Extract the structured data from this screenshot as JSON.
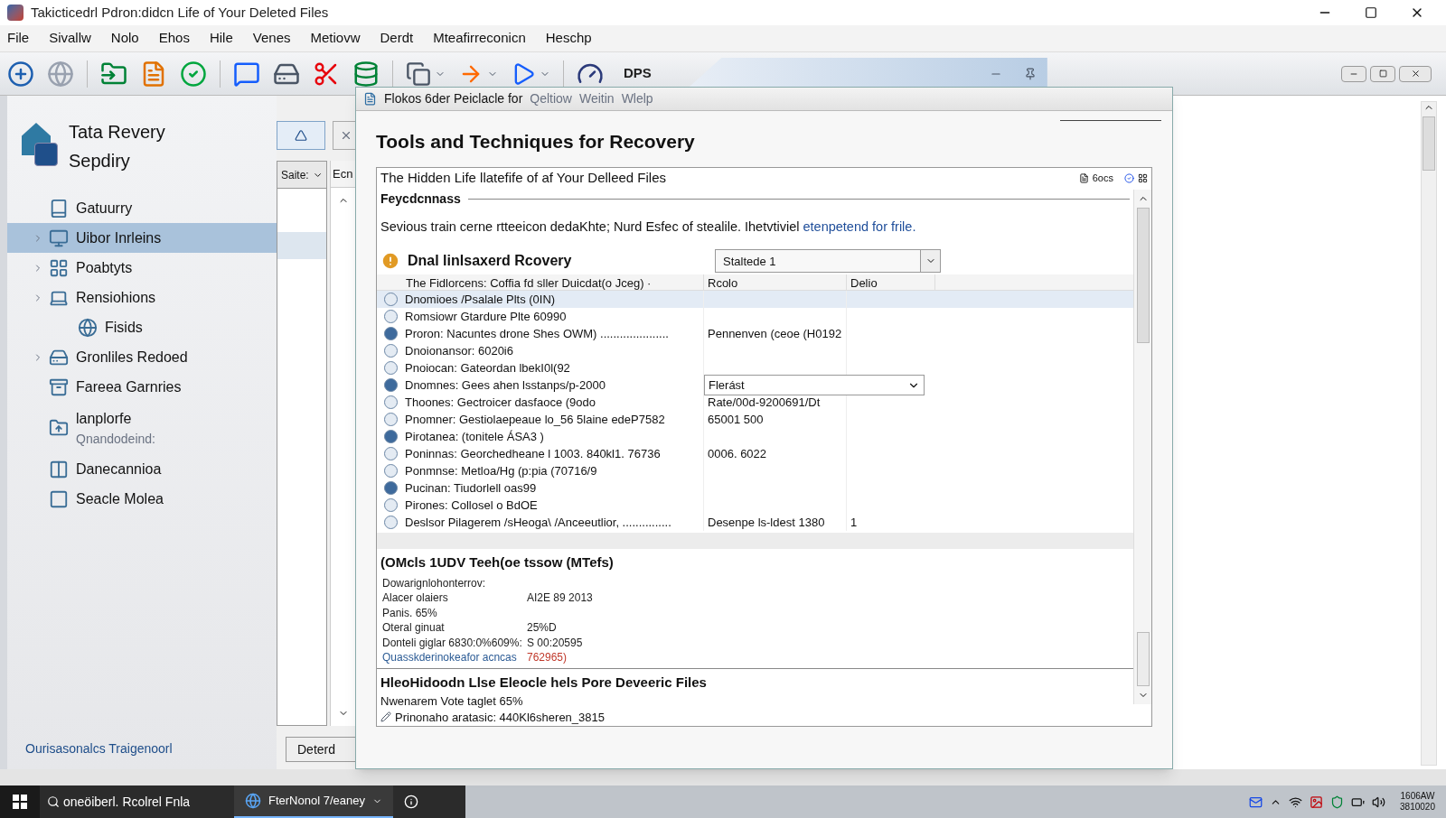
{
  "window": {
    "title": "Takicticedrl Pdron:didcn Life of Your Deleted Files"
  },
  "menu": [
    "File",
    "Sivallw",
    "Nolo",
    "Ehos",
    "Hile",
    "Venes",
    "Metiovw",
    "Derdt",
    "Mteafirreconicn",
    "Heschp"
  ],
  "toolbar": {
    "label": "DPS"
  },
  "sidebar": {
    "app_name": [
      "Tata Revery",
      "Sepdiry"
    ],
    "items": [
      {
        "label": "Gatuurry",
        "expandable": false,
        "selected": false
      },
      {
        "label": "Uibor Inrleins",
        "expandable": true,
        "selected": true
      },
      {
        "label": "Poabtyts",
        "expandable": true,
        "selected": false
      },
      {
        "label": "Rensiohions",
        "expandable": true,
        "selected": false,
        "children": [
          {
            "label": "Fisids",
            "expandable": false,
            "selected": false
          }
        ]
      },
      {
        "label": "Gronliles Redoed",
        "expandable": true,
        "selected": false
      },
      {
        "label": "Fareea Garnries",
        "expandable": false,
        "selected": false
      },
      {
        "label": "lanplorfe",
        "sublabel": "Qnandodeind:",
        "expandable": false,
        "selected": false
      },
      {
        "label": "Danecannioa",
        "expandable": false,
        "selected": false
      },
      {
        "label": "Seacle Molea",
        "expandable": false,
        "selected": false
      }
    ],
    "footer_link": "Ourisasonalcs Traigenoorl"
  },
  "middle": {
    "filter": "Saite:",
    "column_header": "Ecn",
    "button": "Deterd"
  },
  "dialog": {
    "menu": [
      {
        "label": "Flokos 6der Peiclacle for",
        "disabled": false
      },
      {
        "label": "Qeltiow",
        "disabled": true
      },
      {
        "label": "Weitin",
        "disabled": true
      },
      {
        "label": "Wlelp",
        "disabled": true
      }
    ],
    "title": "Tools and Techniques for Recovery",
    "panel": {
      "title": "The Hidden Life llatefife of af Your Delleed Files",
      "counter": "6ocs",
      "section": "Feycdcnnass",
      "paragraph": "Sevious train cerne rtteeicon dedaKhte; Nurd Esfec of stealile. Ihetvtiviel",
      "link": "etenpetend for frile.",
      "recovery": {
        "title": "Dnal linlsaxerd Rcovery",
        "dropdown": "Staltede 1"
      },
      "table": {
        "columns": [
          "The  Fidlorcens:  Coffia fd sller Duicdat(o Jceg) ·",
          "Rcolo",
          "Delio"
        ],
        "rows": [
          {
            "kind": "text",
            "name": "Dnomioes /Psalale Plts (0IN)",
            "selected": true
          },
          {
            "kind": "text",
            "name": "Romsiowr  Gtardure Plte 60990",
            "selected": false
          },
          {
            "kind": "text",
            "name": "Proron:  Nacuntes drone Shes OWM) .....................",
            "value": "Pennenven (ceoe (H0192",
            "selected": false
          },
          {
            "kind": "text",
            "name": "Dnoionansor:  6020i6",
            "selected": false
          },
          {
            "kind": "text",
            "name": "Pnoiocan:  Gateordan lbekI0l(92",
            "selected": false
          },
          {
            "kind": "dropdown",
            "name": "Dnomnes:  Gees ahen lsstanps/p-2000",
            "value": "Flerást",
            "selected": false
          },
          {
            "kind": "text",
            "name": "Thoones:  Gectroicer dasfaoce (9odo",
            "value": "Rate/00d-9200691/Dt",
            "selected": false
          },
          {
            "kind": "text",
            "name": "Pnomner:  Gestiolaepeaue lo_56 5laine edeP7582",
            "value": "65001 500",
            "selected": false
          },
          {
            "kind": "text",
            "name": "Pirotanea:  (tonitele ÁSA3  )",
            "selected": false
          },
          {
            "kind": "text",
            "name": "Poninnas:  Georchedheane l 1003. 840kl1. 76736",
            "value": "0006. 6022",
            "selected": false
          },
          {
            "kind": "text",
            "name": "Ponmnse:  Metloa/Hg (p:pia (70716/9",
            "selected": false
          },
          {
            "kind": "text",
            "name": "Pucinan:  Tiudorlell oas99",
            "selected": false
          },
          {
            "kind": "text",
            "name": "Pirones:  Collosel o BdOE",
            "selected": false
          },
          {
            "kind": "text",
            "name": "Deslsor Pilagerem /sHeoga\\ /Anceeutlior, ...............",
            "value": "Desenpe ls-ldest 1380",
            "extra": "1",
            "selected": false
          }
        ]
      },
      "details": {
        "title": "(OMcls 1UDV Teeh(oe tssow (MTefs)",
        "rows": [
          {
            "kind": "plain",
            "label": "Dowarignlohonterrov:"
          },
          {
            "kind": "plain",
            "label": "Alacer olaiers",
            "value": "AI2E 89 2013"
          },
          {
            "kind": "plain",
            "label": "Panis. 65%"
          },
          {
            "kind": "plain",
            "label": "Oteral ginuat",
            "value": "25%D"
          },
          {
            "kind": "plain",
            "label": "Donteli giglar 6830:0%609%:",
            "value": "S 00:20595"
          },
          {
            "kind": "link",
            "label": "Quasskderinokeafor acncas",
            "value": "762965)"
          }
        ]
      },
      "summary": {
        "title": "HleoHidoodn Llse Eleocle hels Pore Deveeric Files",
        "lines": [
          "Nwenarem Vote taglet 65%",
          "Prinonaho aratasic: 440Kl6sheren_3815"
        ]
      }
    }
  },
  "taskbar": {
    "search": "oneöiberl. Rcolrel Fnla",
    "apps": [
      {
        "label": "FterNonol 7/eaney",
        "selected": true
      }
    ],
    "clock": [
      "1606AW",
      "3810020"
    ]
  }
}
